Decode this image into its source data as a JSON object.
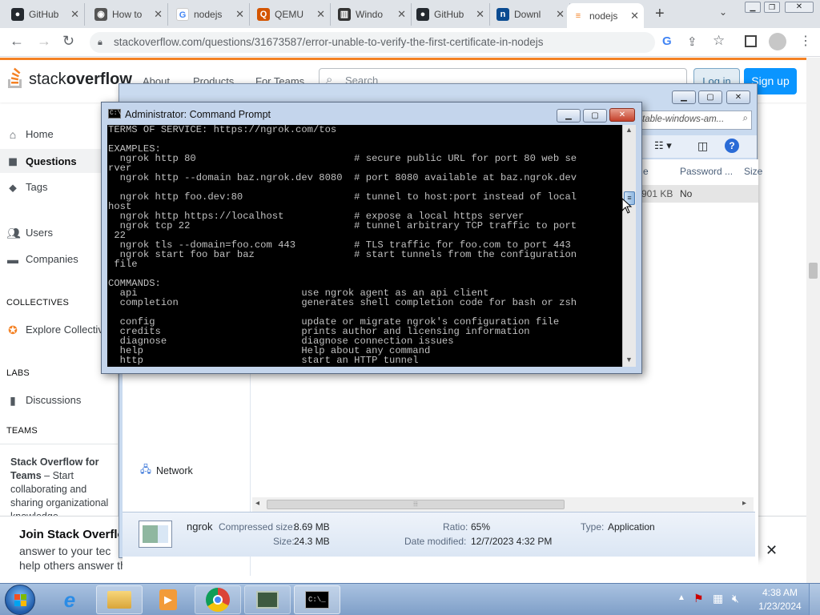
{
  "browser": {
    "tabs": [
      {
        "label": "GitHub",
        "icon": "github-icon"
      },
      {
        "label": "How to",
        "icon": "tutorial-icon"
      },
      {
        "label": "nodejs",
        "icon": "google-icon"
      },
      {
        "label": "QEMU",
        "icon": "qemu-icon"
      },
      {
        "label": "Windo",
        "icon": "window-icon"
      },
      {
        "label": "GitHub",
        "icon": "github-icon"
      },
      {
        "label": "Downl",
        "icon": "download-icon"
      },
      {
        "label": "nodejs",
        "icon": "stackoverflow-icon",
        "active": true
      }
    ],
    "url": "stackoverflow.com/questions/31673587/error-unable-to-verify-the-first-certificate-in-nodejs"
  },
  "so": {
    "logo_a": "stack",
    "logo_b": "overflow",
    "nav": [
      "About",
      "Products",
      "For Teams"
    ],
    "search_placeholder": "Search",
    "login": "Log in",
    "signup": "Sign up",
    "sidebar": {
      "home": "Home",
      "questions": "Questions",
      "tags": "Tags",
      "users": "Users",
      "companies": "Companies",
      "collectives_h": "COLLECTIVES",
      "explore": "Explore Collectives",
      "labs_h": "LABS",
      "discussions": "Discussions",
      "teams_h": "TEAMS",
      "teams_title": "Stack Overflow for Teams",
      "teams_dash": " – Start collaborating and sharing organizational knowledge."
    },
    "join": {
      "title": "Join Stack Overflow",
      "line1": "answer to your tec",
      "line2": "help others answer theirs."
    }
  },
  "explorer": {
    "search_text": "table-windows-am...",
    "col_password": "Password ...",
    "col_size": "Size",
    "col_e": "e",
    "row_size": "901 KB",
    "row_password": "No",
    "network": "Network",
    "details": {
      "name": "ngrok",
      "compressed_label": "Compressed size:",
      "compressed_value": "8.69 MB",
      "size_label": "Size:",
      "size_value": "24.3 MB",
      "ratio_label": "Ratio:",
      "ratio_value": "65%",
      "modified_label": "Date modified:",
      "modified_value": "12/7/2023 4:32 PM",
      "type_label": "Type:",
      "type_value": "Application"
    }
  },
  "cmd": {
    "title": "Administrator: Command Prompt",
    "lines": [
      "TERMS OF SERVICE: https://ngrok.com/tos",
      "",
      "EXAMPLES:",
      "  ngrok http 80                           # secure public URL for port 80 web se",
      "rver",
      "  ngrok http --domain baz.ngrok.dev 8080  # port 8080 available at baz.ngrok.dev",
      "",
      "  ngrok http foo.dev:80                   # tunnel to host:port instead of local",
      "host",
      "  ngrok http https://localhost            # expose a local https server",
      "  ngrok tcp 22                            # tunnel arbitrary TCP traffic to port",
      " 22",
      "  ngrok tls --domain=foo.com 443          # TLS traffic for foo.com to port 443",
      "  ngrok start foo bar baz                 # start tunnels from the configuration",
      " file",
      "",
      "COMMANDS:",
      "  api                            use ngrok agent as an api client",
      "  completion                     generates shell completion code for bash or zsh",
      "",
      "  config                         update or migrate ngrok's configuration file",
      "  credits                        prints author and licensing information",
      "  diagnose                       diagnose connection issues",
      "  help                           Help about any command",
      "  http                           start an HTTP tunnel"
    ]
  },
  "taskbar": {
    "time": "4:38 AM",
    "date": "1/23/2024"
  }
}
